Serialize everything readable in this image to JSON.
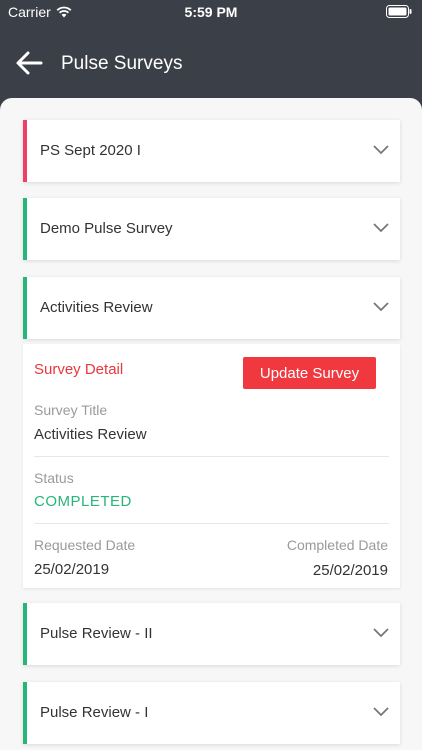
{
  "status_bar": {
    "carrier": "Carrier",
    "time": "5:59 PM"
  },
  "header": {
    "title": "Pulse Surveys"
  },
  "surveys": [
    {
      "title": "PS Sept 2020 I",
      "accent": "#ee3f67"
    },
    {
      "title": "Demo Pulse Survey",
      "accent": "#27b57a"
    },
    {
      "title": "Activities Review",
      "accent": "#27b57a"
    },
    {
      "title": "Pulse Review - II",
      "accent": "#27b57a"
    },
    {
      "title": "Pulse Review - I",
      "accent": "#27b57a"
    }
  ],
  "detail": {
    "section_label": "Survey Detail",
    "update_button": "Update Survey",
    "survey_title_label": "Survey Title",
    "survey_title_value": "Activities Review",
    "status_label": "Status",
    "status_value": "COMPLETED",
    "requested_label": "Requested Date",
    "requested_value": "25/02/2019",
    "completed_label": "Completed Date",
    "completed_value": "25/02/2019"
  },
  "colors": {
    "header_bg": "#3b3f48",
    "accent_green": "#27b57a",
    "accent_red": "#ee3f67",
    "button_red": "#f0393f"
  }
}
